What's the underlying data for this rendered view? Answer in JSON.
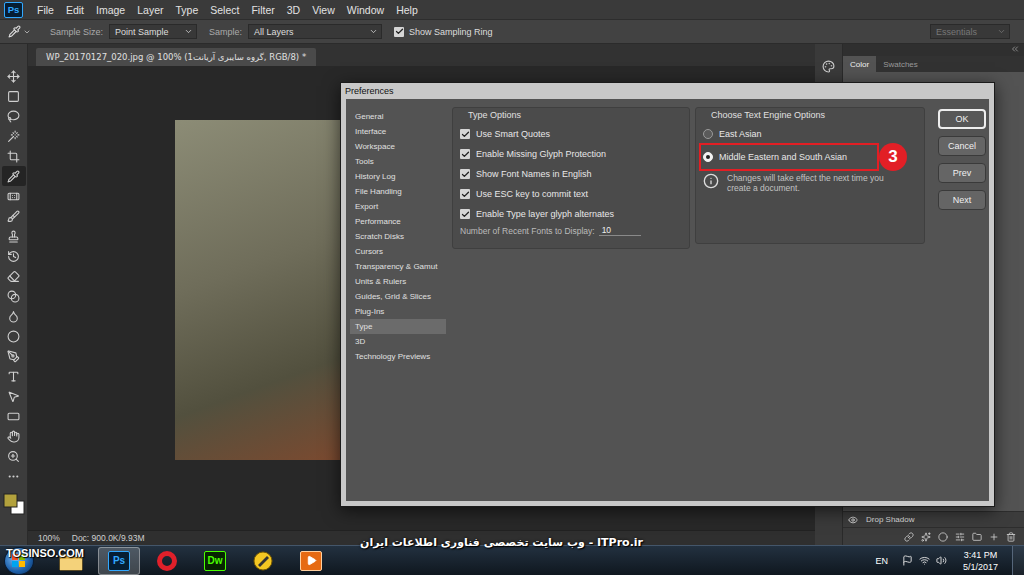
{
  "menu": {
    "logo": "Ps",
    "items": [
      "File",
      "Edit",
      "Image",
      "Layer",
      "Type",
      "Select",
      "Filter",
      "3D",
      "View",
      "Window",
      "Help"
    ]
  },
  "options_bar": {
    "sample_size_label": "Sample Size:",
    "sample_size": "Point Sample",
    "sample_label": "Sample:",
    "sample": "All Layers",
    "sampling_ring": {
      "label": "Show Sampling Ring",
      "checked": true
    },
    "workspace": "Essentials"
  },
  "tools": [
    {
      "selected": false
    },
    {
      "selected": false
    },
    {
      "selected": false
    },
    {
      "selected": false
    },
    {
      "selected": false
    },
    {
      "selected": true
    },
    {
      "selected": false
    },
    {
      "selected": false
    },
    {
      "selected": false
    },
    {
      "selected": false
    },
    {
      "selected": false
    },
    {
      "selected": false
    },
    {
      "selected": false
    },
    {
      "selected": false
    },
    {
      "selected": false
    },
    {
      "selected": false
    },
    {
      "selected": false
    },
    {
      "selected": false
    },
    {
      "selected": false
    },
    {
      "selected": false
    },
    {
      "selected": false
    }
  ],
  "document": {
    "tab": "WP_20170127_020.jpg @ 100% (گروه سایبری آریانت1, RGB/8) *",
    "zoom": "100%",
    "doc_size": "Doc: 900.0K/9.93M"
  },
  "panels": {
    "tabs": [
      {
        "label": "Color",
        "selected": true
      },
      {
        "label": "Swatches",
        "selected": false
      }
    ],
    "effect": "Drop Shadow"
  },
  "dialog": {
    "title": "Preferences",
    "sections": [
      {
        "label": "General",
        "selected": false
      },
      {
        "label": "Interface",
        "selected": false
      },
      {
        "label": "Workspace",
        "selected": false
      },
      {
        "label": "Tools",
        "selected": false
      },
      {
        "label": "History Log",
        "selected": false
      },
      {
        "label": "File Handling",
        "selected": false
      },
      {
        "label": "Export",
        "selected": false
      },
      {
        "label": "Performance",
        "selected": false
      },
      {
        "label": "Scratch Disks",
        "selected": false
      },
      {
        "label": "Cursors",
        "selected": false
      },
      {
        "label": "Transparency & Gamut",
        "selected": false
      },
      {
        "label": "Units & Rulers",
        "selected": false
      },
      {
        "label": "Guides, Grid & Slices",
        "selected": false
      },
      {
        "label": "Plug-Ins",
        "selected": false
      },
      {
        "label": "Type",
        "selected": true
      },
      {
        "label": "3D",
        "selected": false
      },
      {
        "label": "Technology Previews",
        "selected": false
      }
    ],
    "type_options": {
      "title": "Type Options",
      "checkboxes": [
        {
          "label": "Use Smart Quotes",
          "checked": true
        },
        {
          "label": "Enable Missing Glyph Protection",
          "checked": true
        },
        {
          "label": "Show Font Names in English",
          "checked": true
        },
        {
          "label": "Use ESC key to commit text",
          "checked": true
        },
        {
          "label": "Enable Type layer glyph alternates",
          "checked": true
        }
      ],
      "recent_fonts": {
        "label": "Number of Recent Fonts to Display:",
        "value": "10"
      }
    },
    "text_engine": {
      "title": "Choose Text Engine Options",
      "options": [
        {
          "label": "East Asian",
          "selected": false,
          "annotated": false
        },
        {
          "label": "Middle Eastern and South Asian",
          "selected": true,
          "annotated": true
        }
      ],
      "note": "Changes will take effect the next time you create a document."
    },
    "buttons": [
      {
        "label": "OK",
        "default": true
      },
      {
        "label": "Cancel",
        "default": false
      },
      {
        "label": "Prev",
        "default": false
      },
      {
        "label": "Next",
        "default": false
      }
    ]
  },
  "annotation": {
    "badge": "3"
  },
  "taskbar": {
    "apps": [
      {
        "kind": "explorer",
        "active": false
      },
      {
        "kind": "photoshop",
        "label": "Ps",
        "active": true
      },
      {
        "kind": "opera",
        "active": false
      },
      {
        "kind": "dreamweaver",
        "label": "Dw",
        "active": false
      },
      {
        "kind": "tool",
        "active": false
      },
      {
        "kind": "player",
        "active": false
      }
    ],
    "language": "EN",
    "time": "3:41 PM",
    "date": "5/1/2017"
  },
  "watermarks": {
    "corner": "TOSINSO.COM",
    "footer": "وب سایت تخصصی فناوری اطلاعات ایران - ITPro.ir"
  }
}
